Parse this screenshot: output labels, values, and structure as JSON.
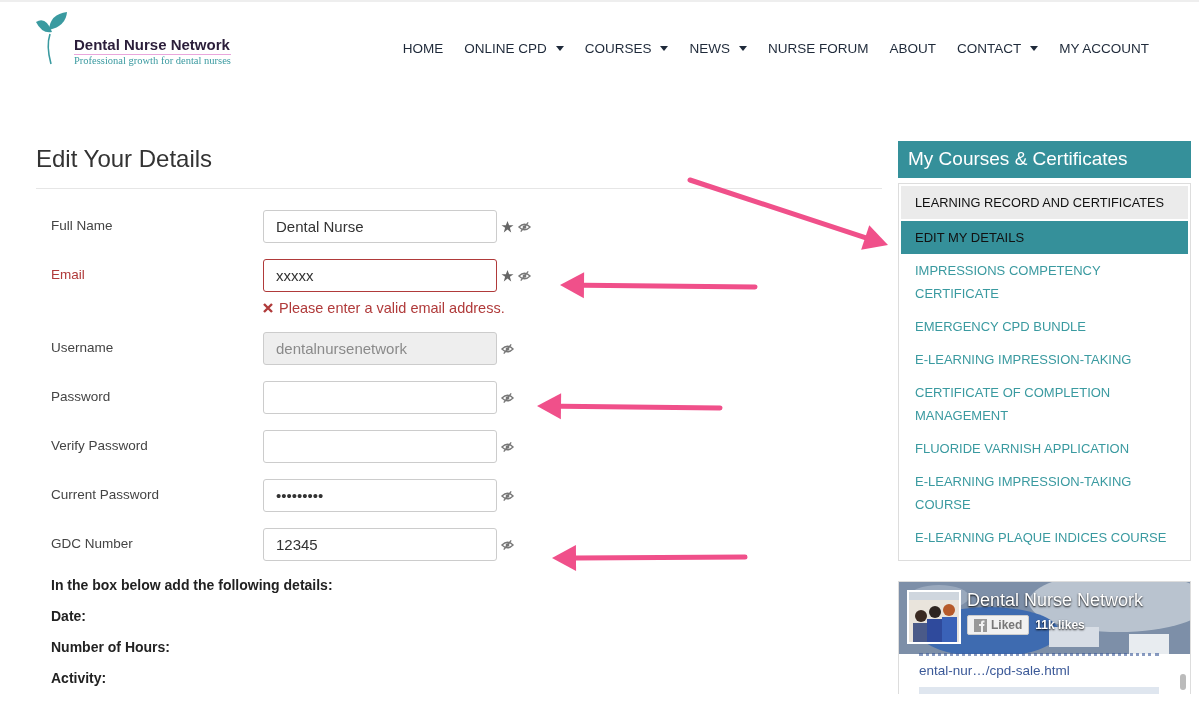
{
  "logo": {
    "name": "Dental Nurse Network",
    "tagline": "Professional growth for dental nurses"
  },
  "nav": [
    {
      "label": "HOME",
      "dropdown": false
    },
    {
      "label": "ONLINE CPD",
      "dropdown": true
    },
    {
      "label": "COURSES",
      "dropdown": true
    },
    {
      "label": "NEWS",
      "dropdown": true
    },
    {
      "label": "NURSE FORUM",
      "dropdown": false
    },
    {
      "label": "ABOUT",
      "dropdown": false
    },
    {
      "label": "CONTACT",
      "dropdown": true
    },
    {
      "label": "MY ACCOUNT",
      "dropdown": false
    }
  ],
  "form": {
    "title": "Edit Your Details",
    "fields": [
      {
        "label": "Full Name",
        "value": "Dental Nurse",
        "required": true,
        "invalid": false,
        "disabled": false
      },
      {
        "label": "Email",
        "value": "xxxxx",
        "required": true,
        "invalid": true,
        "disabled": false,
        "error": "Please enter a valid email address."
      },
      {
        "label": "Username",
        "value": "dentalnursenetwork",
        "required": false,
        "invalid": false,
        "disabled": true
      },
      {
        "label": "Password",
        "required": false,
        "invalid": false,
        "disabled": false
      },
      {
        "label": "Verify Password",
        "required": false,
        "invalid": false,
        "disabled": false
      },
      {
        "label": "Current Password",
        "value": "•••••••••",
        "required": false,
        "invalid": false,
        "disabled": false
      },
      {
        "label": "GDC Number",
        "value": "12345",
        "required": false,
        "invalid": false,
        "disabled": false
      }
    ],
    "notes": [
      "In the box below add the following details:",
      "Date:",
      "Number of Hours:",
      "Activity:"
    ]
  },
  "sidebar": {
    "title": "My Courses & Certificates",
    "items": [
      {
        "label": "LEARNING RECORD AND CERTIFICATES",
        "kind": "record",
        "selected": false
      },
      {
        "label": "EDIT MY DETAILS",
        "kind": "course",
        "selected": true
      },
      {
        "label": "IMPRESSIONS COMPETENCY CERTIFICATE",
        "kind": "course",
        "selected": false
      },
      {
        "label": "EMERGENCY CPD BUNDLE",
        "kind": "course",
        "selected": false
      },
      {
        "label": "E-LEARNING IMPRESSION-TAKING",
        "kind": "course",
        "selected": false
      },
      {
        "label": "CERTIFICATE OF COMPLETION MANAGEMENT",
        "kind": "course",
        "selected": false
      },
      {
        "label": "FLUORIDE VARNISH APPLICATION",
        "kind": "course",
        "selected": false
      },
      {
        "label": "E-LEARNING IMPRESSION-TAKING COURSE",
        "kind": "course",
        "selected": false
      },
      {
        "label": "E-LEARNING PLAQUE INDICES COURSE",
        "kind": "course",
        "selected": false
      }
    ]
  },
  "facebook": {
    "page_name": "Dental Nurse Network",
    "like_button": "Liked",
    "likes": "11k likes",
    "post_link": "ental-nur…/cpd-sale.html"
  }
}
